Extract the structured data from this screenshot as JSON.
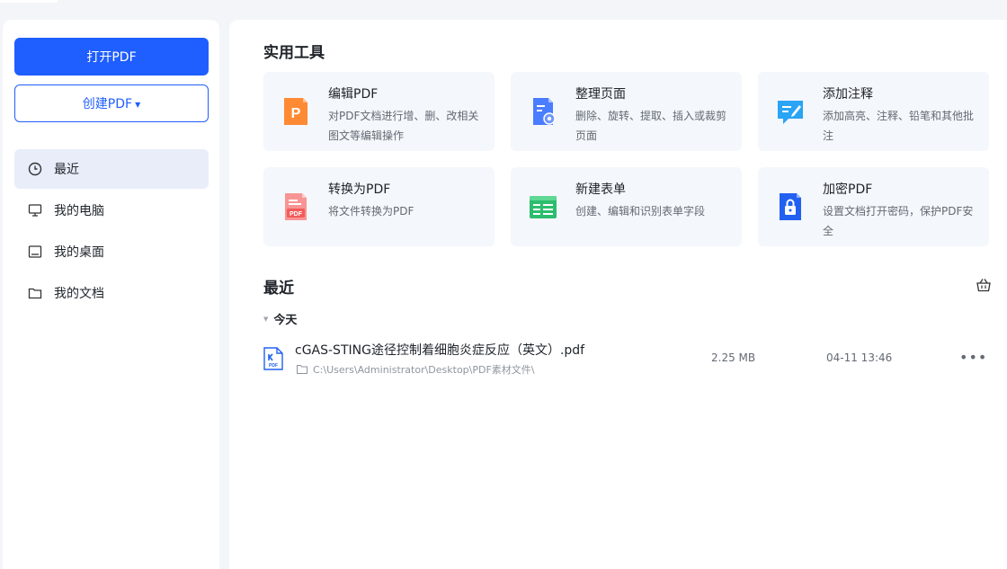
{
  "sidebar": {
    "open_button": "打开PDF",
    "create_button": "创建PDF",
    "nav": [
      {
        "label": "最近",
        "icon": "clock-icon"
      },
      {
        "label": "我的电脑",
        "icon": "monitor-icon"
      },
      {
        "label": "我的桌面",
        "icon": "desktop-icon"
      },
      {
        "label": "我的文档",
        "icon": "folder-icon"
      }
    ]
  },
  "tools": {
    "title": "实用工具",
    "items": [
      {
        "name": "编辑PDF",
        "desc": "对PDF文档进行增、删、改相关图文等编辑操作",
        "icon": "edit-pdf-icon",
        "color": "#ff8a34"
      },
      {
        "name": "整理页面",
        "desc": "删除、旋转、提取、插入或裁剪页面",
        "icon": "organize-pages-icon",
        "color": "#4a7dff"
      },
      {
        "name": "添加注释",
        "desc": "添加高亮、注释、铅笔和其他批注",
        "icon": "annotate-icon",
        "color": "#2aa4f4"
      },
      {
        "name": "转换为PDF",
        "desc": "将文件转换为PDF",
        "icon": "convert-pdf-icon",
        "color": "#f25b5b"
      },
      {
        "name": "新建表单",
        "desc": "创建、编辑和识别表单字段",
        "icon": "form-icon",
        "color": "#2dbd6e"
      },
      {
        "name": "加密PDF",
        "desc": "设置文档打开密码，保护PDF安全",
        "icon": "lock-icon",
        "color": "#2160f0"
      }
    ]
  },
  "recent": {
    "title": "最近",
    "group": "今天",
    "files": [
      {
        "name": "cGAS-STING途径控制着细胞炎症反应（英文）.pdf",
        "path": "C:\\Users\\Administrator\\Desktop\\PDF素材文件\\",
        "size": "2.25 MB",
        "date": "04-11 13:46"
      }
    ]
  },
  "colors": {
    "accent": "#1f5eff",
    "background": "#f3f5f9",
    "card": "#f4f7fb"
  }
}
